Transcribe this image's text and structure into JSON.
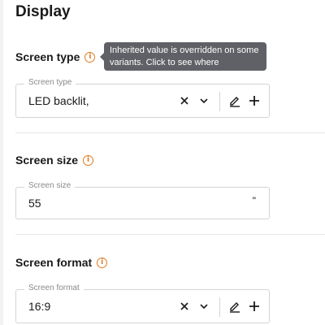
{
  "section": {
    "title": "Display"
  },
  "tooltip": {
    "text": "Inherited value is overridden on some variants. Click to see where"
  },
  "fields": [
    {
      "label": "Screen type",
      "legend": "Screen type",
      "value": "LED backlit,"
    },
    {
      "label": "Screen size",
      "legend": "Screen size",
      "value": "55",
      "unit": "\""
    },
    {
      "label": "Screen format",
      "legend": "Screen format",
      "value": "16:9"
    }
  ],
  "icons": {
    "info": "info-circle-icon",
    "clear": "close-x-icon",
    "dropdown": "chevron-down-icon",
    "edit": "pencil-icon",
    "add": "plus-icon"
  },
  "colors": {
    "info": "#e07a1f",
    "tooltip_bg": "#5f6166",
    "border": "#d4d4d4"
  }
}
